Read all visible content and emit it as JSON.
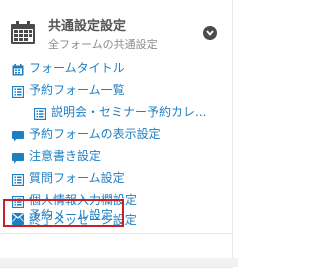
{
  "header": {
    "title": "共通設定設定",
    "subtitle": "全フォームの共通設定",
    "icon": "calendar-icon",
    "toggle_icon": "chevron-down-icon"
  },
  "menu": {
    "items": [
      {
        "label": "フォームタイトル",
        "icon": "calendar-icon"
      },
      {
        "label": "予約フォーム一覧",
        "icon": "list-icon"
      },
      {
        "label": "説明会・セミナー予約カレ...",
        "icon": "list-icon"
      },
      {
        "label": "予約フォームの表示設定",
        "icon": "comment-icon"
      },
      {
        "label": "注意書き設定",
        "icon": "comment-icon"
      },
      {
        "label": "質問フォーム設定",
        "icon": "list-icon"
      },
      {
        "label": "個人情報入力欄設定",
        "icon": "list-icon"
      },
      {
        "label": "終了メッセージ設定",
        "icon": "comment-icon"
      },
      {
        "label": "予約メール設定",
        "icon": "envelope-icon"
      }
    ]
  },
  "colors": {
    "link": "#1f7fc3",
    "highlight": "#c8202a",
    "header_text": "#555555"
  }
}
